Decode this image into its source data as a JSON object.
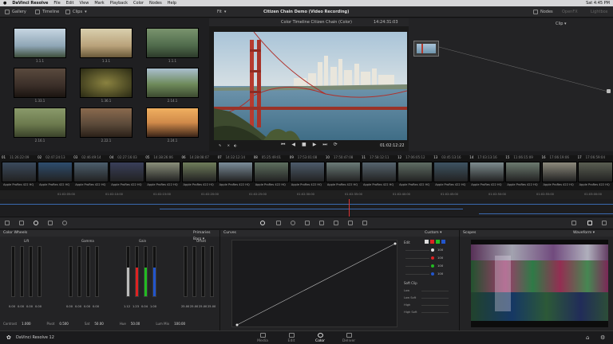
{
  "menubar": {
    "app": "DaVinci Resolve",
    "items": [
      "File",
      "Edit",
      "View",
      "Mark",
      "Playback",
      "Color",
      "Nodes",
      "Help"
    ],
    "clock": "Sat 4:45 PM"
  },
  "toolbar": {
    "gallery": "Gallery",
    "timeline": "Timeline",
    "clips": "Clips",
    "fit": "Fit",
    "title": "Citizen Chain Demo (Video Recording)",
    "nodes": "Nodes",
    "opencfx": "OpenFX",
    "lightbox": "Lightbox",
    "clip_mode": "Clip"
  },
  "gallery": {
    "stills": [
      {
        "label": "1.1.1",
        "color": "#9bb3c4"
      },
      {
        "label": "1.3.1",
        "color": "#b9a27a"
      },
      {
        "label": "1.1.1",
        "color": "#4f6a4b"
      },
      {
        "label": "1.33.1",
        "color": "#3a2e28"
      },
      {
        "label": "1.36.1",
        "color": "#4c4a2a"
      },
      {
        "label": "2.14.1",
        "color": "#6e8a5a"
      },
      {
        "label": "2.16.1",
        "color": "#6c7a4e"
      },
      {
        "label": "2.22.1",
        "color": "#5b4a3a"
      },
      {
        "label": "2.24.1",
        "color": "#d08a4a"
      }
    ]
  },
  "viewer": {
    "timeline_label": "Color Timeline Citizen Chain (Color)",
    "timecode_top": "14:24:31:03",
    "timecode": "01:02:12:22"
  },
  "clips": [
    {
      "num": "01",
      "tc": "11:26:22:09",
      "color": "#3b4a5c"
    },
    {
      "num": "02",
      "tc": "02:47:24:13",
      "color": "#2e4d6e"
    },
    {
      "num": "03",
      "tc": "02:46:49:14",
      "color": "#4c5e6d"
    },
    {
      "num": "04",
      "tc": "02:27:16:03",
      "color": "#3a3f5a"
    },
    {
      "num": "05",
      "tc": "14:38:26:06",
      "color": "#8a8f7a"
    },
    {
      "num": "06",
      "tc": "14:28:08:07",
      "color": "#6f7d5b"
    },
    {
      "num": "07",
      "tc": "14:32:12:14",
      "color": "#7b8d9a"
    },
    {
      "num": "08",
      "tc": "05:25:49:01",
      "color": "#5e6f5f"
    },
    {
      "num": "09",
      "tc": "17:53:01:08",
      "color": "#4d5b6b"
    },
    {
      "num": "10",
      "tc": "17:50:47:08",
      "color": "#6b7b78"
    },
    {
      "num": "11",
      "tc": "17:58:12:11",
      "color": "#56646e"
    },
    {
      "num": "12",
      "tc": "17:06:05:12",
      "color": "#5f6d64"
    },
    {
      "num": "13",
      "tc": "03:45:13:16",
      "color": "#3e5362"
    },
    {
      "num": "14",
      "tc": "17:03:13:16",
      "color": "#7d8c8f"
    },
    {
      "num": "15",
      "tc": "11:06:15:09",
      "color": "#6c7a6f"
    },
    {
      "num": "16",
      "tc": "17:06:19:06",
      "color": "#8d8a7c"
    },
    {
      "num": "17",
      "tc": "17:06:59:04",
      "color": "#5a5e52"
    }
  ],
  "clip_codec": "Apple ProRes 422 HQ",
  "ruler_marks": [
    "01:02:05:00",
    "01:02:10:00",
    "01:02:15:00",
    "01:02:20:00",
    "01:02:25:00",
    "01:02:30:00",
    "01:02:35:00",
    "01:02:40:00",
    "01:02:45:00",
    "01:02:50:00",
    "01:02:55:00",
    "01:03:00:00"
  ],
  "color_wheels": {
    "title": "Color Wheels",
    "mode": "Primaries Bars",
    "groups": [
      {
        "name": "Lift",
        "values": [
          "0.00",
          "0.00",
          "0.00",
          "0.00"
        ]
      },
      {
        "name": "Gamma",
        "values": [
          "0.00",
          "0.00",
          "0.00",
          "0.00"
        ]
      },
      {
        "name": "Gain",
        "values": [
          "1.12",
          "1.23",
          "0.04",
          "1.00"
        ]
      },
      {
        "name": "Offset",
        "values": [
          "25.00",
          "25.00",
          "25.00",
          "25.00"
        ]
      }
    ],
    "footer": [
      {
        "label": "Contrast",
        "value": "1.000"
      },
      {
        "label": "Pivot",
        "value": "0.500"
      },
      {
        "label": "Sat",
        "value": "50.00"
      },
      {
        "label": "Hue",
        "value": "50.00"
      },
      {
        "label": "Lum Mix",
        "value": "100.00"
      }
    ]
  },
  "curves": {
    "title": "Curves",
    "mode": "Custom",
    "edit_label": "Edit",
    "edit_values": [
      "100",
      "100",
      "100",
      "100"
    ],
    "soft_clip": "Soft Clip",
    "soft_rows": [
      "Low",
      "Low Soft",
      "High",
      "High Soft"
    ]
  },
  "scopes": {
    "title": "Scopes",
    "mode": "Waveform"
  },
  "nav": {
    "project": "DaVinci Resolve 12",
    "pages": [
      "Media",
      "Edit",
      "Color",
      "Deliver"
    ],
    "active": "Color"
  }
}
